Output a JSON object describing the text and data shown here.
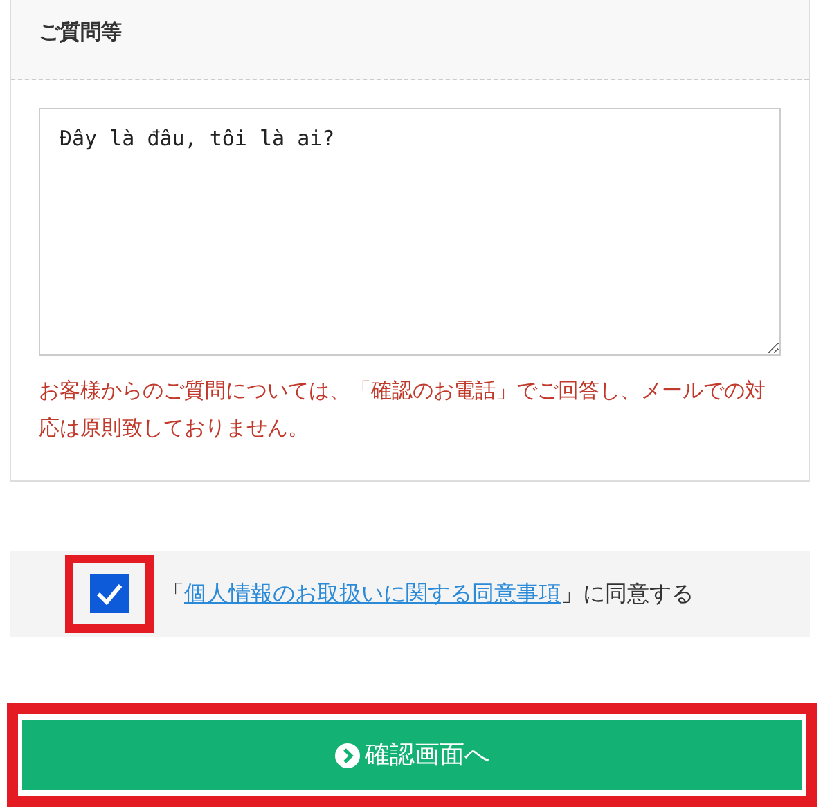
{
  "question_section": {
    "heading": "ご質問等",
    "message": "Đây là đâu, tôi là ai?",
    "note": "お客様からのご質問については、「確認のお電話」でご回答し、メールでの対応は原則致しておりません。"
  },
  "consent": {
    "checked": true,
    "highlighted": true,
    "prefix": "「",
    "link": "個人情報のお取扱いに関する同意事項",
    "suffix": "」に同意する"
  },
  "submit_button": {
    "label": "確認画面へ",
    "highlighted": true
  }
}
